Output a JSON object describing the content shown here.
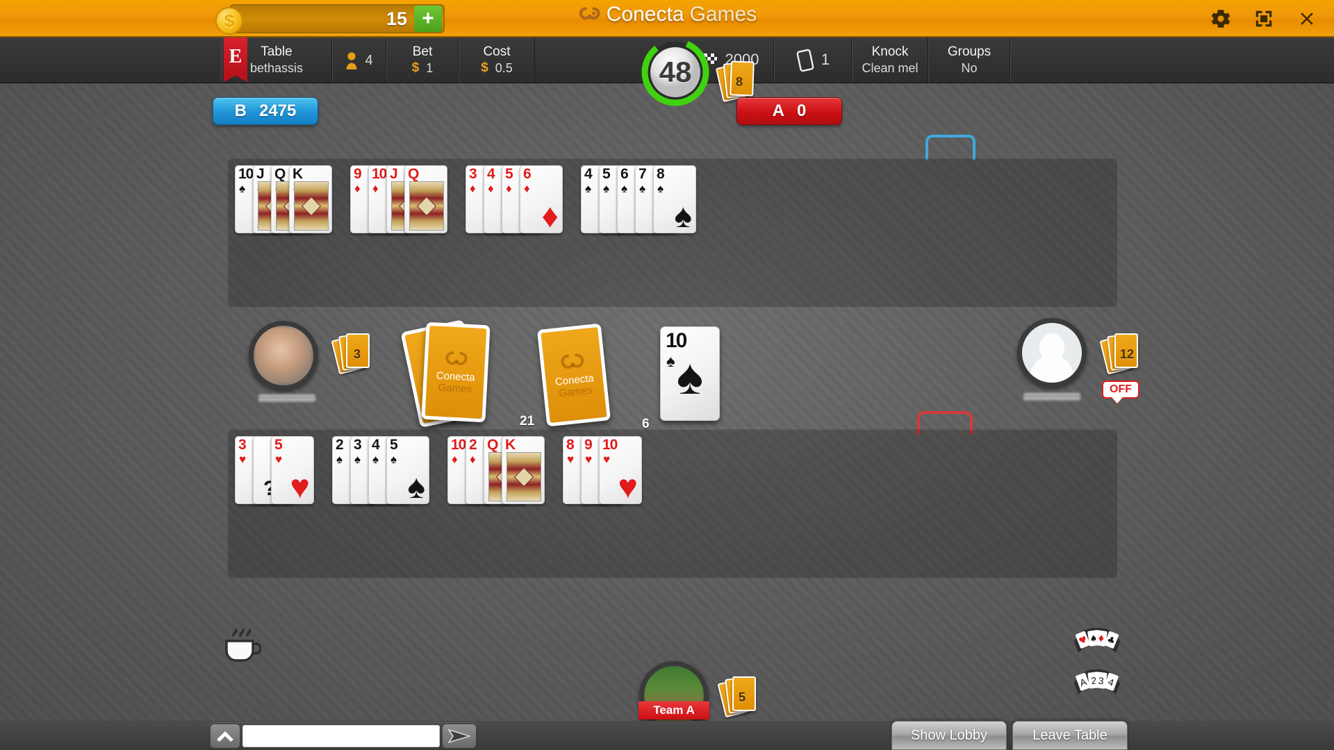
{
  "topbar": {
    "coin_icon": "dollar-coin-icon",
    "coin_amount": "15",
    "add_label": "+",
    "brand_part1": "Conecta",
    "brand_part2": "Games",
    "settings_icon": "gear-icon",
    "fullscreen_icon": "fullscreen-icon",
    "close_icon": "close-icon"
  },
  "infobar": {
    "flag_label": "E",
    "table_label": "Table",
    "table_value": "bethassis",
    "players_icon": "player-icon",
    "players_value": "4",
    "bet_label": "Bet",
    "bet_currency": "$",
    "bet_value": "1",
    "cost_label": "Cost",
    "cost_currency": "$",
    "cost_value": "0.5",
    "timer_value": "48",
    "timer_cards_count": "8",
    "points_icon": "checkered-flag-icon",
    "points_value": "2000",
    "decks_icon": "card-deck-icon",
    "decks_value": "1",
    "knock_label": "Knock",
    "knock_value": "Clean mel",
    "groups_label": "Groups",
    "groups_value": "No"
  },
  "scores": {
    "team_b_label": "B",
    "team_b_value": "2475",
    "team_a_label": "A",
    "team_a_value": "0"
  },
  "melds_top": [
    {
      "cards": [
        {
          "rank": "10",
          "suit": "spade",
          "color": "black",
          "face": false
        },
        {
          "rank": "J",
          "suit": "spade",
          "color": "black",
          "face": true
        },
        {
          "rank": "Q",
          "suit": "spade",
          "color": "black",
          "face": true
        },
        {
          "rank": "K",
          "suit": "spade",
          "color": "black",
          "face": true
        }
      ]
    },
    {
      "cards": [
        {
          "rank": "9",
          "suit": "diamond",
          "color": "red",
          "face": false
        },
        {
          "rank": "10",
          "suit": "diamond",
          "color": "red",
          "face": false
        },
        {
          "rank": "J",
          "suit": "diamond",
          "color": "red",
          "face": true
        },
        {
          "rank": "Q",
          "suit": "diamond",
          "color": "red",
          "face": true
        }
      ]
    },
    {
      "cards": [
        {
          "rank": "3",
          "suit": "diamond",
          "color": "red",
          "face": false
        },
        {
          "rank": "4",
          "suit": "diamond",
          "color": "red",
          "face": false
        },
        {
          "rank": "5",
          "suit": "diamond",
          "color": "red",
          "face": false
        },
        {
          "rank": "6",
          "suit": "diamond",
          "color": "red",
          "face": false
        }
      ]
    },
    {
      "cards": [
        {
          "rank": "4",
          "suit": "spade",
          "color": "black",
          "face": false
        },
        {
          "rank": "5",
          "suit": "spade",
          "color": "black",
          "face": false
        },
        {
          "rank": "6",
          "suit": "spade",
          "color": "black",
          "face": false
        },
        {
          "rank": "7",
          "suit": "spade",
          "color": "black",
          "face": false
        },
        {
          "rank": "8",
          "suit": "spade",
          "color": "black",
          "face": false
        }
      ]
    }
  ],
  "melds_bottom": [
    {
      "cards": [
        {
          "rank": "3",
          "suit": "heart",
          "color": "red",
          "face": false
        },
        {
          "rank": "JOKER",
          "suit": "joker",
          "color": "black",
          "face": false
        },
        {
          "rank": "5",
          "suit": "heart",
          "color": "red",
          "face": false
        }
      ]
    },
    {
      "cards": [
        {
          "rank": "2",
          "suit": "spade",
          "color": "black",
          "face": false
        },
        {
          "rank": "3",
          "suit": "spade",
          "color": "black",
          "face": false
        },
        {
          "rank": "4",
          "suit": "spade",
          "color": "black",
          "face": false
        },
        {
          "rank": "5",
          "suit": "spade",
          "color": "black",
          "face": false
        }
      ]
    },
    {
      "cards": [
        {
          "rank": "10",
          "suit": "diamond",
          "color": "red",
          "face": false
        },
        {
          "rank": "2",
          "suit": "diamond",
          "color": "red",
          "face": false
        },
        {
          "rank": "Q",
          "suit": "diamond",
          "color": "red",
          "face": true
        },
        {
          "rank": "K",
          "suit": "diamond",
          "color": "red",
          "face": true
        }
      ]
    },
    {
      "cards": [
        {
          "rank": "8",
          "suit": "heart",
          "color": "red",
          "face": false
        },
        {
          "rank": "9",
          "suit": "heart",
          "color": "red",
          "face": false
        },
        {
          "rank": "10",
          "suit": "heart",
          "color": "red",
          "face": false
        }
      ]
    }
  ],
  "table": {
    "stock_label": "21",
    "discard_label": "6",
    "discard_card": {
      "rank": "10",
      "suit": "spade",
      "color": "black"
    },
    "back_text_1": "Conecta",
    "back_text_2": "Games",
    "draw_pile_label": ""
  },
  "players": {
    "left": {
      "hand_count": "3",
      "avatar": "blurred-photo-avatar"
    },
    "right": {
      "hand_count": "12",
      "avatar": "default-user-avatar",
      "status": "OFF"
    },
    "bottom": {
      "hand_count": "5",
      "avatar": "blurred-photo-avatar",
      "team_label": "Team A"
    }
  },
  "helpers": {
    "coffee_icon": "coffee-cup-icon",
    "suits_icon": "suit-group-icon",
    "sequence_icon": "sequence-group-icon",
    "sequence_cards": [
      "A",
      "2",
      "3",
      "4"
    ],
    "suit_cards": [
      "heart",
      "spade",
      "diamond",
      "club"
    ]
  },
  "bottombar": {
    "chat_toggle_icon": "chevron-up-icon",
    "chat_value": "",
    "chat_placeholder": "",
    "send_icon": "send-icon",
    "show_lobby_label": "Show Lobby",
    "leave_table_label": "Leave Table"
  },
  "colors": {
    "brand_orange": "#f0a81b",
    "team_a_red": "#cc1014",
    "team_b_blue": "#1f93d6",
    "timer_green": "#3fd30f"
  }
}
